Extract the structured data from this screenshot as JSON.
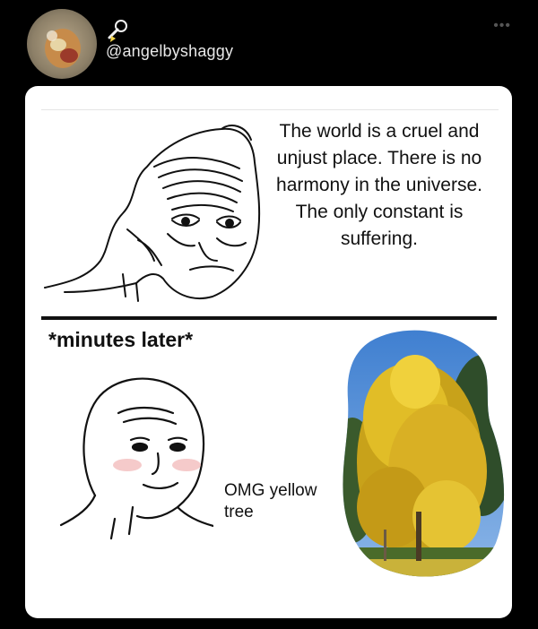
{
  "post": {
    "username": "@angelbyshaggy",
    "more_label": "•••"
  },
  "meme": {
    "top_text": "The world is a cruel and unjust place. There is no harmony in the universe. The only constant is suffering.",
    "caption": "*minutes later*",
    "bottom_text": "OMG yellow tree"
  },
  "icons": {
    "avatar": "avatar-photo",
    "badge": "ringbell-icon",
    "more": "more-icon"
  }
}
